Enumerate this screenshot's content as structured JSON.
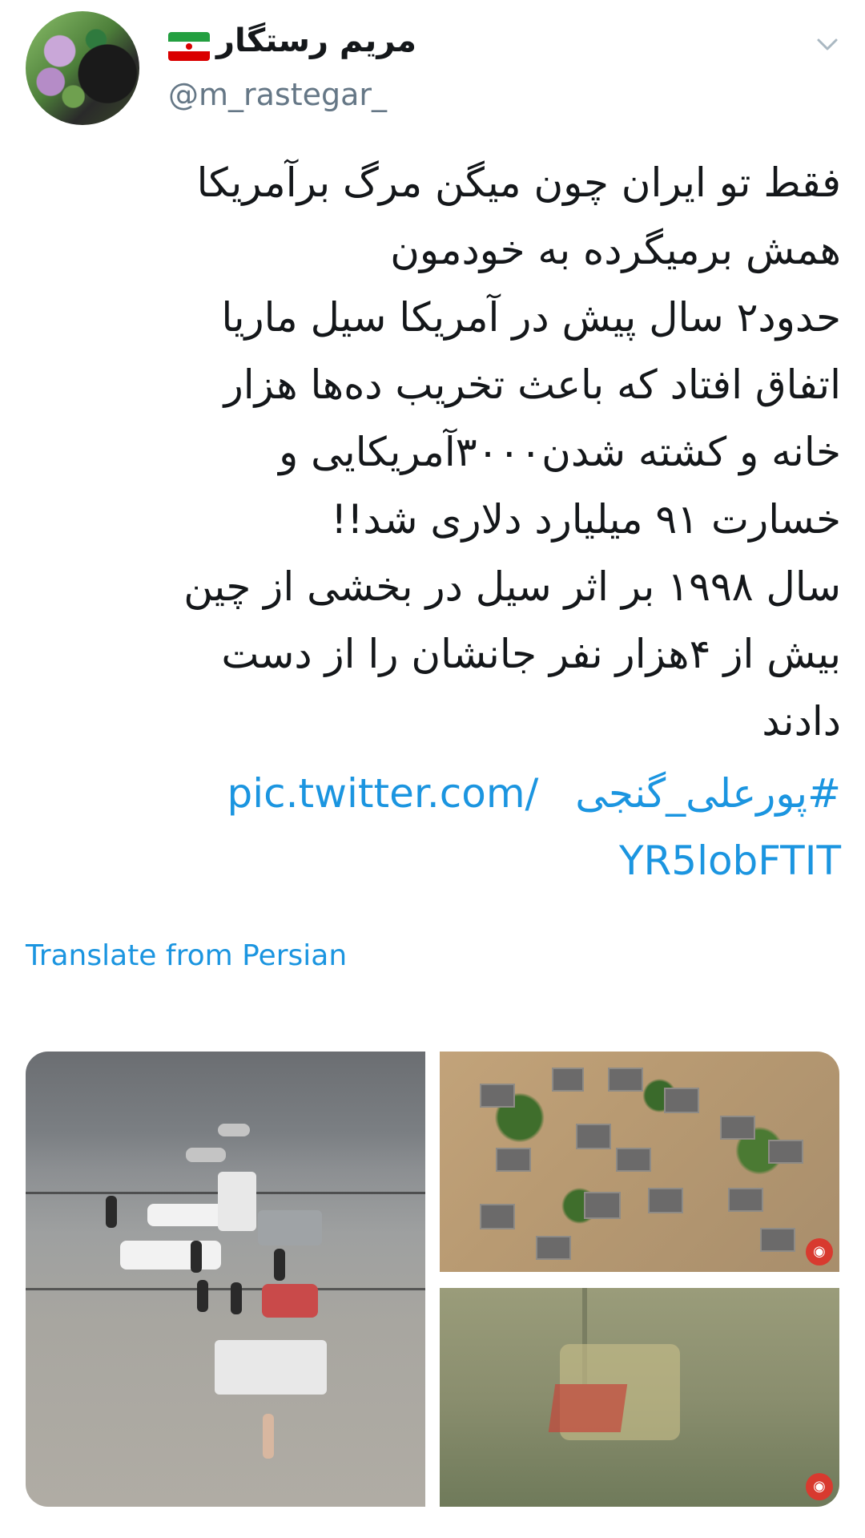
{
  "author": {
    "display_name": "مریم رستگار",
    "handle": "@m_rastegar_",
    "flag_icon": "iran-flag-icon"
  },
  "tweet": {
    "text": "فقط تو ایران چون میگن مرگ برآمریکا\nهمش برمیگرده به خودمون\nحدود۲ سال پیش در آمریکا سیل ماریا\nاتفاق افتاد که باعث تخریب ده‌ها هزار\nخانه و کشته شدن۳۰۰۰آمریکایی و\nخسارت ۹۱ میلیارد دلاری شد!!\nسال ۱۹۹۸ بر اثر سیل در بخشی از چین\nبیش از ۴هزار نفر جانشان را از دست\nدادند",
    "hashtag": "#پورعلی_گنجی",
    "link_part1": "pic.twitter.com/",
    "link_part2": "YR5lobFTIT",
    "translate_label": "Translate from Persian"
  },
  "colors": {
    "link": "#1b95e0",
    "text": "#14171a",
    "secondary": "#657786"
  }
}
